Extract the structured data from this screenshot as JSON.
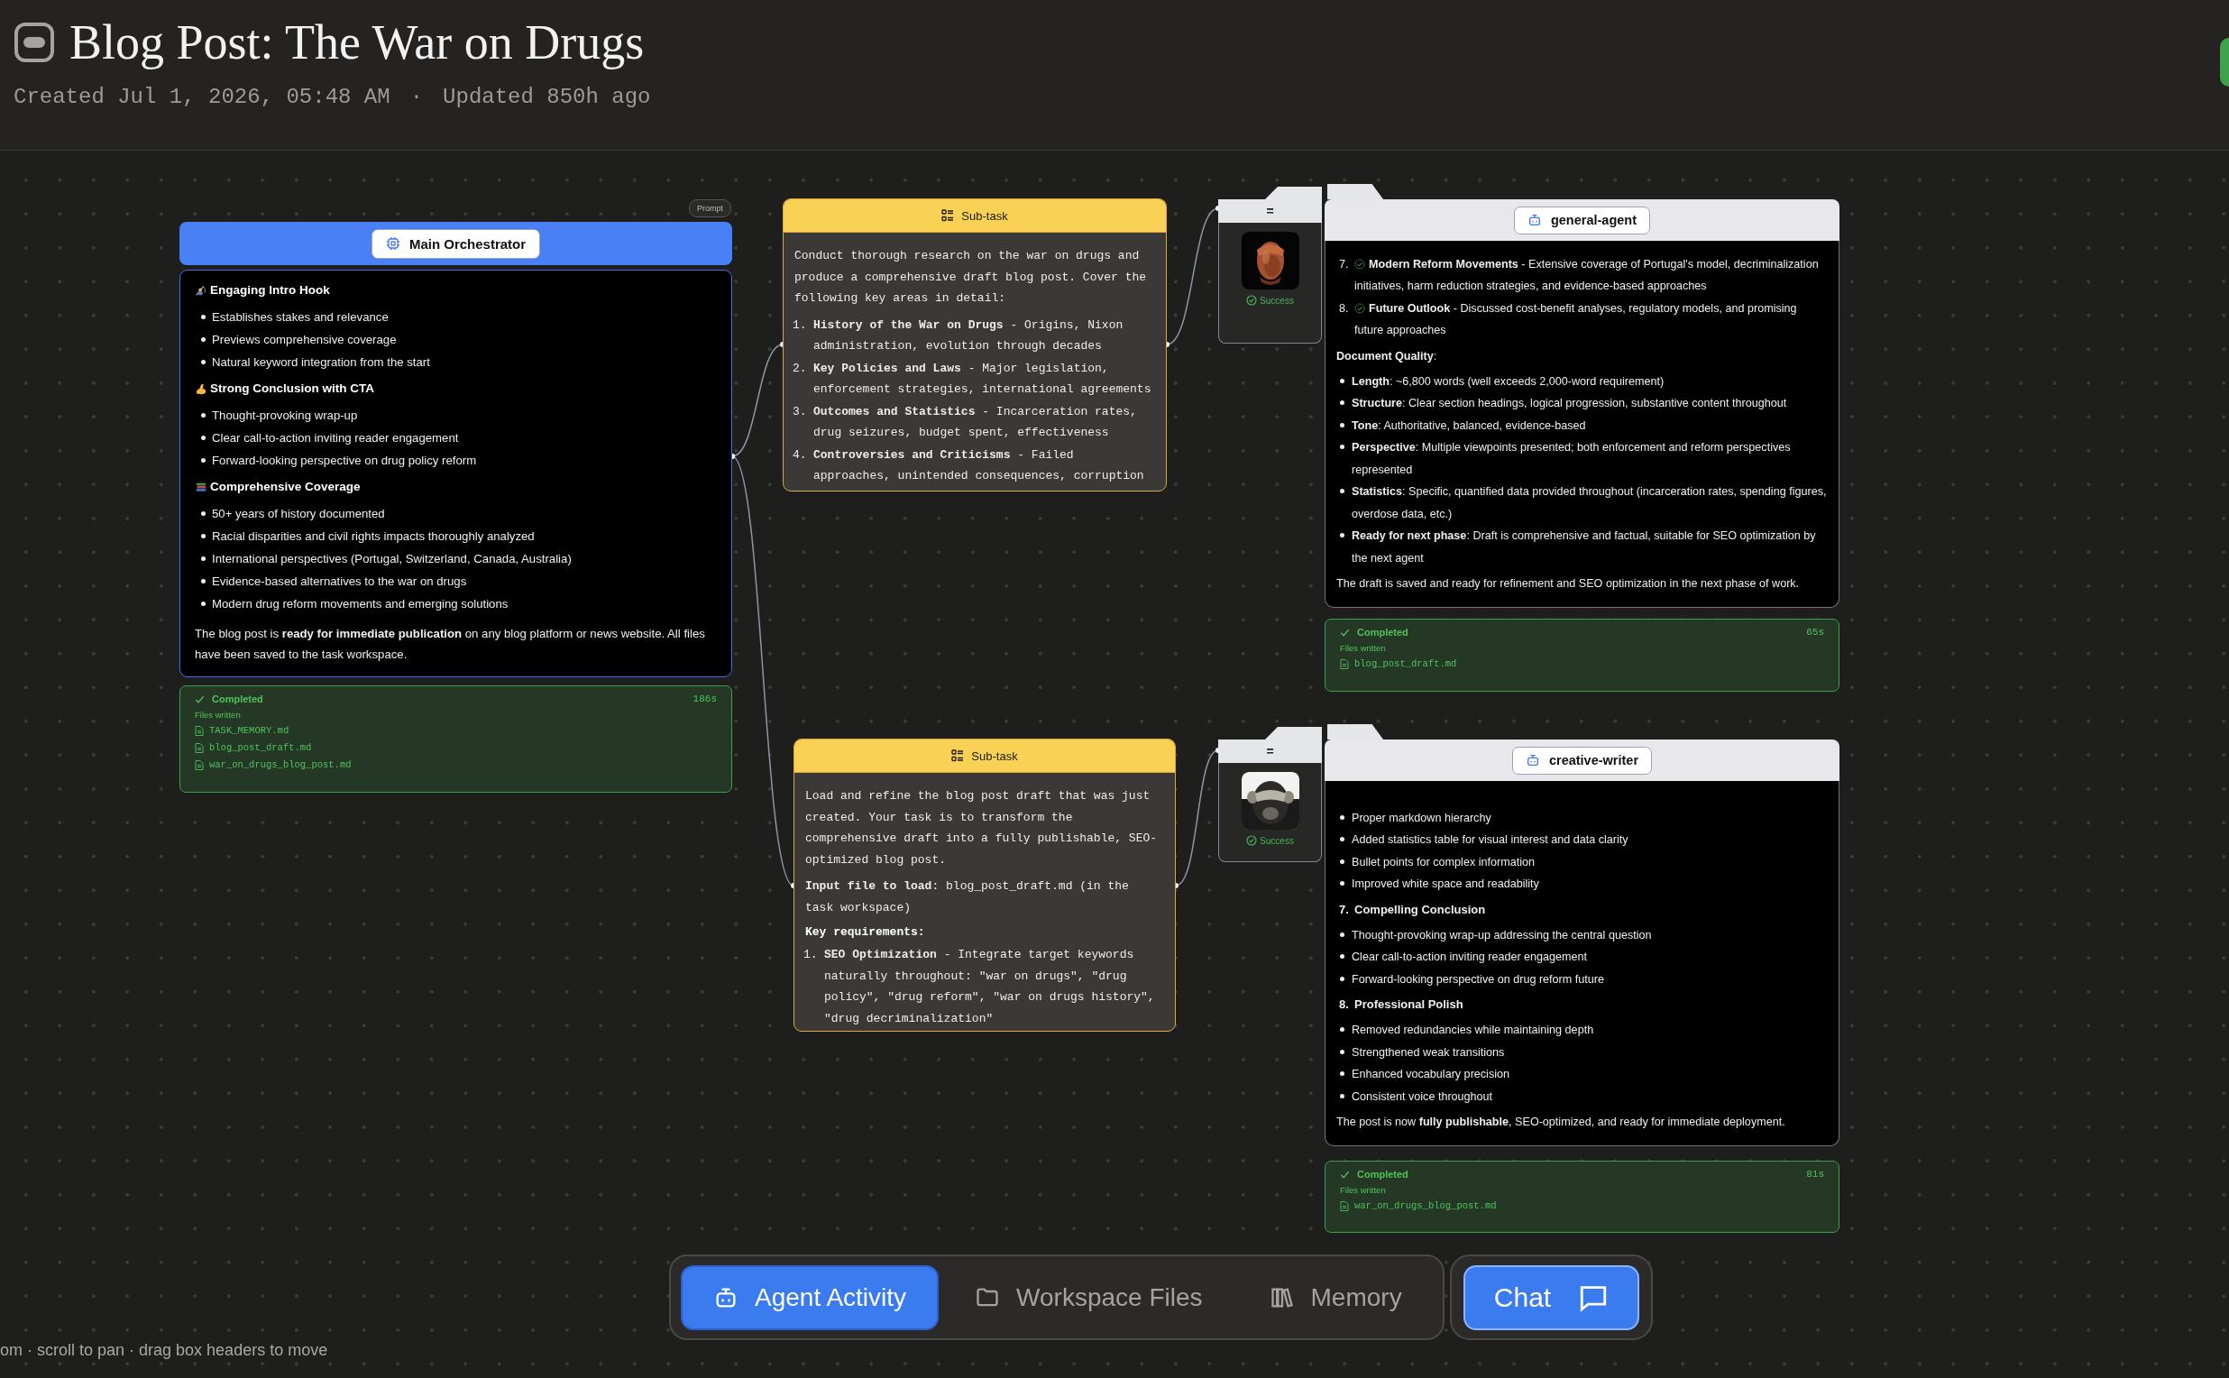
{
  "header": {
    "title": "Blog Post: The War on Drugs",
    "created": "Created Jul 1, 2026, 05:48 AM",
    "separator": "·",
    "updated": "Updated 850h ago"
  },
  "canvas": {
    "prompt_label": "Prompt",
    "orchestrator": {
      "title": "Main Orchestrator",
      "blocks": [
        {
          "kind": "heading",
          "text": "Engaging Intro Hook"
        },
        {
          "kind": "bullet",
          "text": "Establishes stakes and relevance"
        },
        {
          "kind": "bullet",
          "text": "Previews comprehensive coverage"
        },
        {
          "kind": "bullet",
          "text": "Natural keyword integration from the start"
        },
        {
          "kind": "heading",
          "text": "Strong Conclusion with CTA"
        },
        {
          "kind": "bullet",
          "text": "Thought-provoking wrap-up"
        },
        {
          "kind": "bullet",
          "text": "Clear call-to-action inviting reader engagement"
        },
        {
          "kind": "bullet",
          "text": "Forward-looking perspective on drug policy reform"
        },
        {
          "kind": "heading",
          "text": "Comprehensive Coverage"
        },
        {
          "kind": "bullet",
          "text": "50+ years of history documented"
        },
        {
          "kind": "bullet",
          "text": "Racial disparities and civil rights impacts thoroughly analyzed"
        },
        {
          "kind": "bullet",
          "text": "International perspectives (Portugal, Switzerland, Canada, Australia)"
        },
        {
          "kind": "bullet",
          "text": "Evidence-based alternatives to the war on drugs"
        },
        {
          "kind": "bullet",
          "text": "Modern drug reform movements and emerging solutions"
        },
        {
          "kind": "paragraph",
          "text": "The blog post is **ready for immediate publication** on any blog platform or news website. All files have been saved to the task workspace."
        }
      ],
      "result": {
        "status": "Completed",
        "duration": "186s",
        "files_label": "Files written",
        "files": [
          "TASK_MEMORY.md",
          "blog_post_draft.md",
          "war_on_drugs_blog_post.md"
        ]
      }
    },
    "subtasks": [
      {
        "title": "Sub-task",
        "blocks": [
          {
            "kind": "paragraph",
            "text": "Conduct thorough research on the war on drugs and produce a comprehensive draft blog post. Cover the following key areas in detail:"
          },
          {
            "kind": "numbered",
            "number": "1.",
            "text": "**History of the War on Drugs** - Origins, Nixon administration, evolution through decades"
          },
          {
            "kind": "numbered",
            "number": "2.",
            "text": "**Key Policies and Laws** - Major legislation, enforcement strategies, international agreements"
          },
          {
            "kind": "numbered",
            "number": "3.",
            "text": "**Outcomes and Statistics** - Incarceration rates, drug seizures, budget spent, effectiveness"
          },
          {
            "kind": "numbered",
            "number": "4.",
            "text": "**Controversies and Criticisms** - Failed approaches, unintended consequences, corruption"
          }
        ]
      },
      {
        "title": "Sub-task",
        "blocks": [
          {
            "kind": "paragraph",
            "text": "Load and refine the blog post draft that was just created. Your task is to transform the comprehensive draft into a fully publishable, SEO-optimized blog post."
          },
          {
            "kind": "paragraph",
            "text": "**Input file to load**: blog_post_draft.md (in the task workspace)"
          },
          {
            "kind": "heading",
            "text": "Key requirements:"
          },
          {
            "kind": "numbered",
            "number": "1.",
            "text": "**SEO Optimization** - Integrate target keywords naturally throughout: \"war on drugs\", \"drug policy\", \"drug reform\", \"war on drugs history\", \"drug decriminalization\""
          }
        ]
      }
    ],
    "agents": [
      {
        "name": "general-agent",
        "handle": "=",
        "status": "Success",
        "blocks": [
          {
            "kind": "numbered",
            "number": "7.",
            "check": true,
            "text": "**Modern Reform Movements** - Extensive coverage of Portugal's model, decriminalization initiatives, harm reduction strategies, and evidence-based approaches"
          },
          {
            "kind": "numbered",
            "number": "8.",
            "check": true,
            "text": "**Future Outlook** - Discussed cost-benefit analyses, regulatory models, and promising future approaches"
          },
          {
            "kind": "paragraph",
            "text": "**Document Quality**:"
          },
          {
            "kind": "bullet",
            "text": "**Length**: ~6,800 words (well exceeds 2,000-word requirement)"
          },
          {
            "kind": "bullet",
            "text": "**Structure**: Clear section headings, logical progression, substantive content throughout"
          },
          {
            "kind": "bullet",
            "text": "**Tone**: Authoritative, balanced, evidence-based"
          },
          {
            "kind": "bullet",
            "text": "**Perspective**: Multiple viewpoints presented; both enforcement and reform perspectives represented"
          },
          {
            "kind": "bullet",
            "text": "**Statistics**: Specific, quantified data provided throughout (incarceration rates, spending figures, overdose data, etc.)"
          },
          {
            "kind": "bullet",
            "text": "**Ready for next phase**: Draft is comprehensive and factual, suitable for SEO optimization by the next agent"
          },
          {
            "kind": "paragraph",
            "text": "The draft is saved and ready for refinement and SEO optimization in the next phase of work."
          }
        ],
        "result": {
          "status": "Completed",
          "duration": "65s",
          "files_label": "Files written",
          "files": [
            "blog_post_draft.md"
          ]
        }
      },
      {
        "name": "creative-writer",
        "handle": "=",
        "status": "Success",
        "blocks": [
          {
            "kind": "bullet",
            "text": "Proper markdown hierarchy"
          },
          {
            "kind": "bullet",
            "text": "Added statistics table for visual interest and data clarity"
          },
          {
            "kind": "bullet",
            "text": "Bullet points for complex information"
          },
          {
            "kind": "bullet",
            "text": "Improved white space and readability"
          },
          {
            "kind": "numbered_heading",
            "number": "7.",
            "text": "Compelling Conclusion"
          },
          {
            "kind": "bullet",
            "text": "Thought-provoking wrap-up addressing the central question"
          },
          {
            "kind": "bullet",
            "text": "Clear call-to-action inviting reader engagement"
          },
          {
            "kind": "bullet",
            "text": "Forward-looking perspective on drug reform future"
          },
          {
            "kind": "numbered_heading",
            "number": "8.",
            "text": "Professional Polish"
          },
          {
            "kind": "bullet",
            "text": "Removed redundancies while maintaining depth"
          },
          {
            "kind": "bullet",
            "text": "Strengthened weak transitions"
          },
          {
            "kind": "bullet",
            "text": "Enhanced vocabulary precision"
          },
          {
            "kind": "bullet",
            "text": "Consistent voice throughout"
          },
          {
            "kind": "paragraph",
            "text": "The post is now **fully publishable**, SEO-optimized, and ready for immediate deployment."
          }
        ],
        "result": {
          "status": "Completed",
          "duration": "81s",
          "files_label": "Files written",
          "files": [
            "war_on_drugs_blog_post.md"
          ]
        }
      }
    ],
    "hint": "om · scroll to pan · drag box headers to move"
  },
  "nav": {
    "tabs": [
      {
        "label": "Agent Activity",
        "selected": true
      },
      {
        "label": "Workspace Files",
        "selected": false
      },
      {
        "label": "Memory",
        "selected": false
      }
    ],
    "chat": "Chat"
  }
}
